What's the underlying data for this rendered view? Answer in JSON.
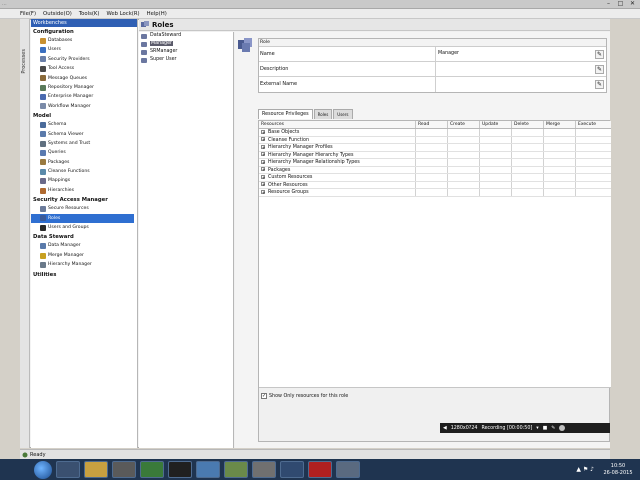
{
  "window": {
    "title": "...",
    "controls": [
      "–",
      "□",
      "✕"
    ]
  },
  "menu": [
    "File(F)",
    "Outside(O)",
    "Tools(K)",
    "Web Lock(R)",
    "Help(H)"
  ],
  "process_bar_label": "Processes",
  "nav": {
    "header": "Workbenches",
    "sections": [
      {
        "title": "Configuration",
        "items": [
          {
            "label": "Databases",
            "icon": "database-icon",
            "color": "#c89030"
          },
          {
            "label": "Users",
            "icon": "users-icon",
            "color": "#3a6fc0"
          },
          {
            "label": "Security Providers",
            "icon": "security-icon",
            "color": "#6a7fa8"
          },
          {
            "label": "Tool Access",
            "icon": "tool-icon",
            "color": "#4a4a4a"
          },
          {
            "label": "Message Queues",
            "icon": "queue-icon",
            "color": "#8a6a3a"
          },
          {
            "label": "Repository Manager",
            "icon": "repository-icon",
            "color": "#5a7a5a"
          },
          {
            "label": "Enterprise Manager",
            "icon": "enterprise-icon",
            "color": "#4a6ab0"
          },
          {
            "label": "Workflow Manager",
            "icon": "workflow-icon",
            "color": "#7a8aa8"
          }
        ]
      },
      {
        "title": "Model",
        "items": [
          {
            "label": "Schema",
            "icon": "schema-icon",
            "color": "#4a6a9a"
          },
          {
            "label": "Schema Viewer",
            "icon": "viewer-icon",
            "color": "#5a7aaa"
          },
          {
            "label": "Systems and Trust",
            "icon": "systems-icon",
            "color": "#607080"
          },
          {
            "label": "Queries",
            "icon": "query-icon",
            "color": "#5a7ab0"
          },
          {
            "label": "Packages",
            "icon": "package-icon",
            "color": "#9a7a40"
          },
          {
            "label": "Cleanse Functions",
            "icon": "cleanse-icon",
            "color": "#5a8aaa"
          },
          {
            "label": "Mappings",
            "icon": "mapping-icon",
            "color": "#6a6a8a"
          },
          {
            "label": "Hierarchies",
            "icon": "hierarchy-icon",
            "color": "#b06a30"
          }
        ]
      },
      {
        "title": "Security Access Manager",
        "items": [
          {
            "label": "Secure Resources",
            "icon": "secure-resources-icon",
            "color": "#6a7a9a"
          },
          {
            "label": "Roles",
            "icon": "roles-icon",
            "color": "#3a5a9a",
            "selected": true
          },
          {
            "label": "Users and Groups",
            "icon": "user-group-icon",
            "color": "#2a2a2a"
          }
        ]
      },
      {
        "title": "Data Steward",
        "items": [
          {
            "label": "Data Manager",
            "icon": "data-manager-icon",
            "color": "#5a7aaa"
          },
          {
            "label": "Merge Manager",
            "icon": "merge-icon",
            "color": "#c8a020"
          },
          {
            "label": "Hierarchy Manager",
            "icon": "hierarchy-manager-icon",
            "color": "#6a7a8a"
          }
        ]
      },
      {
        "title": "Utilities",
        "items": []
      }
    ]
  },
  "main": {
    "title": "Roles",
    "roles": [
      "DataSteward",
      "Manager",
      "SRManager",
      "Super User"
    ],
    "selected_role_index": 1,
    "role_header": "Role",
    "fields": [
      {
        "label": "Name",
        "value": "Manager"
      },
      {
        "label": "Description",
        "value": ""
      },
      {
        "label": "External Name",
        "value": ""
      }
    ],
    "tabs": [
      "Resource Privileges",
      "Roles",
      "Users"
    ],
    "table": {
      "columns": [
        "Resources",
        "Read",
        "Create",
        "Update",
        "Delete",
        "Merge",
        "Execute"
      ],
      "rows": [
        "Base Objects",
        "Cleanse Function",
        "Hierarchy Manager Profiles",
        "Hierarchy Manager Hierarchy Types",
        "Hierarchy Manager Relationship Types",
        "Packages",
        "Custom Resources",
        "Other Resources",
        "Resource Groups"
      ]
    },
    "show_only_label": "Show Only resources for this role",
    "show_only_checked": true
  },
  "status": {
    "text": "Ready"
  },
  "recording": {
    "resolution": "1280x0?24",
    "label": "Recording [00:00:50]"
  },
  "taskbar": {
    "time": "10:50",
    "date": "26-08-2015"
  }
}
